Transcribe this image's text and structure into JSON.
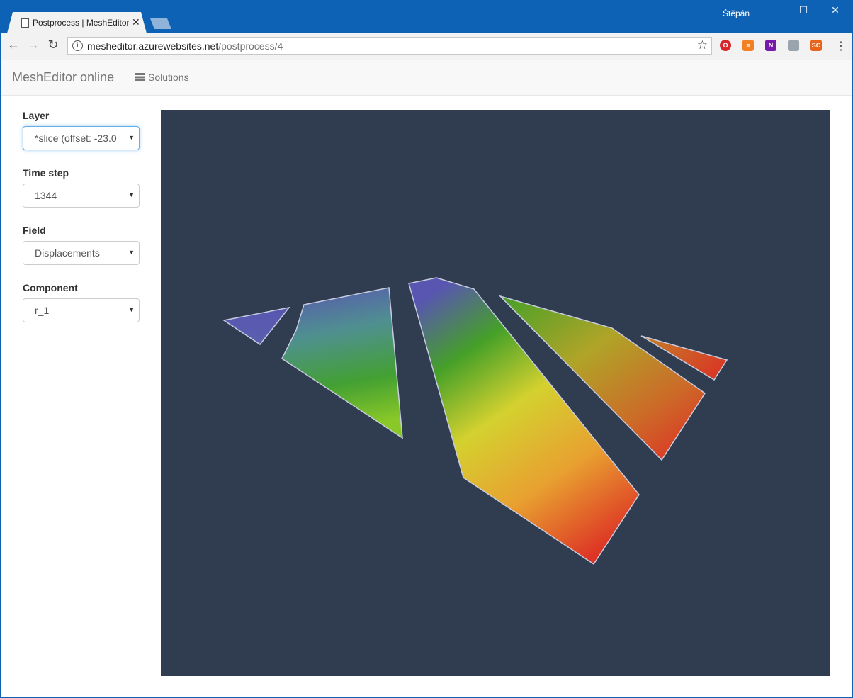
{
  "browser": {
    "tab_title": "Postprocess | MeshEditor online",
    "tab_close": "✕",
    "user": "Štěpán",
    "url_host": "mesheditor.azurewebsites.net",
    "url_path": "/postprocess/4",
    "extensions": [
      {
        "name": "opera-icon",
        "label": "O",
        "color": "#d9252a"
      },
      {
        "name": "stackoverflow-icon",
        "label": "≡",
        "color": "#f48024"
      },
      {
        "name": "onenote-icon",
        "label": "N",
        "color": "#7719aa"
      },
      {
        "name": "image-extension-icon",
        "label": "",
        "color": "#9aa4ad"
      },
      {
        "name": "sc-extension-icon",
        "label": "SC",
        "color": "#e8641b"
      }
    ]
  },
  "navbar": {
    "brand": "MeshEditor online",
    "solutions": "Solutions"
  },
  "sidebar": {
    "layer": {
      "label": "Layer",
      "value": "*slice (offset: -23.0"
    },
    "timestep": {
      "label": "Time step",
      "value": "1344"
    },
    "field": {
      "label": "Field",
      "value": "Displacements"
    },
    "component": {
      "label": "Component",
      "value": "r_1"
    }
  },
  "viewer": {
    "background": "#303d50",
    "colormap": [
      "#5856b0",
      "#45a028",
      "#d4d12f",
      "#e8a030",
      "#dd3425"
    ]
  }
}
